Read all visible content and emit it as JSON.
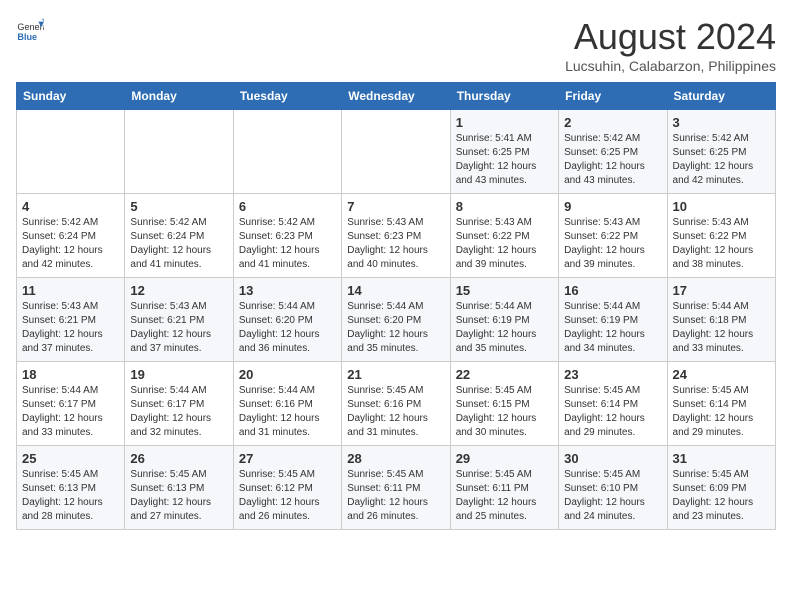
{
  "header": {
    "logo_general": "General",
    "logo_blue": "Blue",
    "month_year": "August 2024",
    "location": "Lucsuhin, Calabarzon, Philippines"
  },
  "weekdays": [
    "Sunday",
    "Monday",
    "Tuesday",
    "Wednesday",
    "Thursday",
    "Friday",
    "Saturday"
  ],
  "weeks": [
    [
      {
        "day": "",
        "info": ""
      },
      {
        "day": "",
        "info": ""
      },
      {
        "day": "",
        "info": ""
      },
      {
        "day": "",
        "info": ""
      },
      {
        "day": "1",
        "info": "Sunrise: 5:41 AM\nSunset: 6:25 PM\nDaylight: 12 hours\nand 43 minutes."
      },
      {
        "day": "2",
        "info": "Sunrise: 5:42 AM\nSunset: 6:25 PM\nDaylight: 12 hours\nand 43 minutes."
      },
      {
        "day": "3",
        "info": "Sunrise: 5:42 AM\nSunset: 6:25 PM\nDaylight: 12 hours\nand 42 minutes."
      }
    ],
    [
      {
        "day": "4",
        "info": "Sunrise: 5:42 AM\nSunset: 6:24 PM\nDaylight: 12 hours\nand 42 minutes."
      },
      {
        "day": "5",
        "info": "Sunrise: 5:42 AM\nSunset: 6:24 PM\nDaylight: 12 hours\nand 41 minutes."
      },
      {
        "day": "6",
        "info": "Sunrise: 5:42 AM\nSunset: 6:23 PM\nDaylight: 12 hours\nand 41 minutes."
      },
      {
        "day": "7",
        "info": "Sunrise: 5:43 AM\nSunset: 6:23 PM\nDaylight: 12 hours\nand 40 minutes."
      },
      {
        "day": "8",
        "info": "Sunrise: 5:43 AM\nSunset: 6:22 PM\nDaylight: 12 hours\nand 39 minutes."
      },
      {
        "day": "9",
        "info": "Sunrise: 5:43 AM\nSunset: 6:22 PM\nDaylight: 12 hours\nand 39 minutes."
      },
      {
        "day": "10",
        "info": "Sunrise: 5:43 AM\nSunset: 6:22 PM\nDaylight: 12 hours\nand 38 minutes."
      }
    ],
    [
      {
        "day": "11",
        "info": "Sunrise: 5:43 AM\nSunset: 6:21 PM\nDaylight: 12 hours\nand 37 minutes."
      },
      {
        "day": "12",
        "info": "Sunrise: 5:43 AM\nSunset: 6:21 PM\nDaylight: 12 hours\nand 37 minutes."
      },
      {
        "day": "13",
        "info": "Sunrise: 5:44 AM\nSunset: 6:20 PM\nDaylight: 12 hours\nand 36 minutes."
      },
      {
        "day": "14",
        "info": "Sunrise: 5:44 AM\nSunset: 6:20 PM\nDaylight: 12 hours\nand 35 minutes."
      },
      {
        "day": "15",
        "info": "Sunrise: 5:44 AM\nSunset: 6:19 PM\nDaylight: 12 hours\nand 35 minutes."
      },
      {
        "day": "16",
        "info": "Sunrise: 5:44 AM\nSunset: 6:19 PM\nDaylight: 12 hours\nand 34 minutes."
      },
      {
        "day": "17",
        "info": "Sunrise: 5:44 AM\nSunset: 6:18 PM\nDaylight: 12 hours\nand 33 minutes."
      }
    ],
    [
      {
        "day": "18",
        "info": "Sunrise: 5:44 AM\nSunset: 6:17 PM\nDaylight: 12 hours\nand 33 minutes."
      },
      {
        "day": "19",
        "info": "Sunrise: 5:44 AM\nSunset: 6:17 PM\nDaylight: 12 hours\nand 32 minutes."
      },
      {
        "day": "20",
        "info": "Sunrise: 5:44 AM\nSunset: 6:16 PM\nDaylight: 12 hours\nand 31 minutes."
      },
      {
        "day": "21",
        "info": "Sunrise: 5:45 AM\nSunset: 6:16 PM\nDaylight: 12 hours\nand 31 minutes."
      },
      {
        "day": "22",
        "info": "Sunrise: 5:45 AM\nSunset: 6:15 PM\nDaylight: 12 hours\nand 30 minutes."
      },
      {
        "day": "23",
        "info": "Sunrise: 5:45 AM\nSunset: 6:14 PM\nDaylight: 12 hours\nand 29 minutes."
      },
      {
        "day": "24",
        "info": "Sunrise: 5:45 AM\nSunset: 6:14 PM\nDaylight: 12 hours\nand 29 minutes."
      }
    ],
    [
      {
        "day": "25",
        "info": "Sunrise: 5:45 AM\nSunset: 6:13 PM\nDaylight: 12 hours\nand 28 minutes."
      },
      {
        "day": "26",
        "info": "Sunrise: 5:45 AM\nSunset: 6:13 PM\nDaylight: 12 hours\nand 27 minutes."
      },
      {
        "day": "27",
        "info": "Sunrise: 5:45 AM\nSunset: 6:12 PM\nDaylight: 12 hours\nand 26 minutes."
      },
      {
        "day": "28",
        "info": "Sunrise: 5:45 AM\nSunset: 6:11 PM\nDaylight: 12 hours\nand 26 minutes."
      },
      {
        "day": "29",
        "info": "Sunrise: 5:45 AM\nSunset: 6:11 PM\nDaylight: 12 hours\nand 25 minutes."
      },
      {
        "day": "30",
        "info": "Sunrise: 5:45 AM\nSunset: 6:10 PM\nDaylight: 12 hours\nand 24 minutes."
      },
      {
        "day": "31",
        "info": "Sunrise: 5:45 AM\nSunset: 6:09 PM\nDaylight: 12 hours\nand 23 minutes."
      }
    ]
  ]
}
